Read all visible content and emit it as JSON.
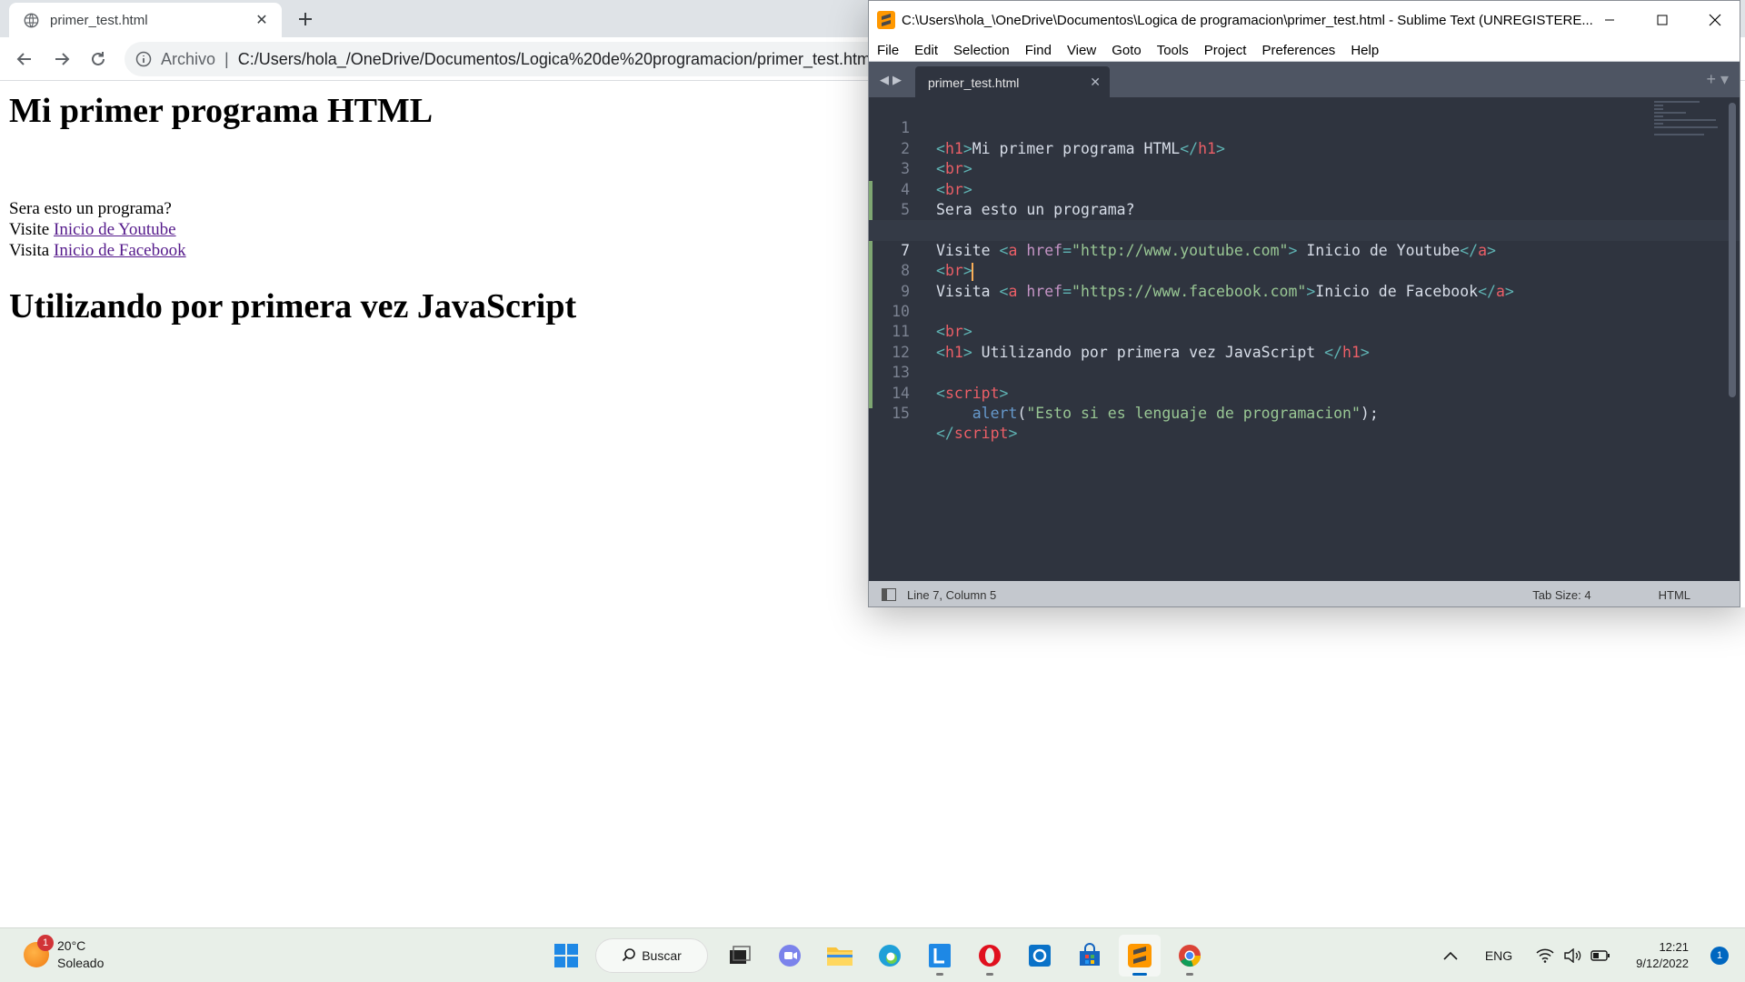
{
  "browser": {
    "tab_title": "primer_test.html",
    "address": {
      "scheme_label": "Archivo",
      "url": "C:/Users/hola_/OneDrive/Documentos/Logica%20de%20programacion/primer_test.html"
    }
  },
  "page": {
    "heading1": "Mi primer programa HTML",
    "question": "Sera esto un programa?",
    "youtube_prefix": "Visite",
    "youtube_link": "Inicio de Youtube",
    "facebook_prefix": "Visita",
    "facebook_link": "Inicio de Facebook",
    "heading2": "Utilizando por primera vez JavaScript"
  },
  "sublime": {
    "window_title": "C:\\Users\\hola_\\OneDrive\\Documentos\\Logica de programacion\\primer_test.html - Sublime Text (UNREGISTERE...",
    "menu": [
      "File",
      "Edit",
      "Selection",
      "Find",
      "View",
      "Goto",
      "Tools",
      "Project",
      "Preferences",
      "Help"
    ],
    "tab_title": "primer_test.html",
    "status": {
      "position": "Line 7, Column 5",
      "tab_size": "Tab Size: 4",
      "syntax": "HTML"
    },
    "current_line": 7,
    "code": {
      "l1_open": "h1",
      "l1_text": "Mi primer programa HTML",
      "l1_close": "h1",
      "br": "br",
      "l4_text": "Sera esto un programa?",
      "l6_pre": "Visite ",
      "l6_tag": "a",
      "l6_attr": "href",
      "l6_val": "\"http://www.youtube.com\"",
      "l6_text": " Inicio de Youtube",
      "l6_close": "a",
      "l8_pre": "Visita ",
      "l8_val": "\"https://www.facebook.com\"",
      "l8_text": "Inicio de Facebook",
      "l11_text": " Utilizando por primera vez JavaScript ",
      "script": "script",
      "l14_func": "alert",
      "l14_paren_open": "(",
      "l14_str": "\"Esto si es lenguaje de programacion\"",
      "l14_end": ");"
    }
  },
  "taskbar": {
    "weather_temp": "20°C",
    "weather_desc": "Soleado",
    "weather_badge": "1",
    "search_label": "Buscar",
    "language": "ENG",
    "time": "12:21",
    "date": "9/12/2022",
    "notifications": "1",
    "apps": [
      "start-icon",
      "search",
      "task-view-icon",
      "teams-chat-icon",
      "file-explorer-icon",
      "edge-icon",
      "libreoffice-icon",
      "opera-icon",
      "outlook-icon",
      "store-icon",
      "sublime-text-icon",
      "chrome-icon"
    ]
  }
}
